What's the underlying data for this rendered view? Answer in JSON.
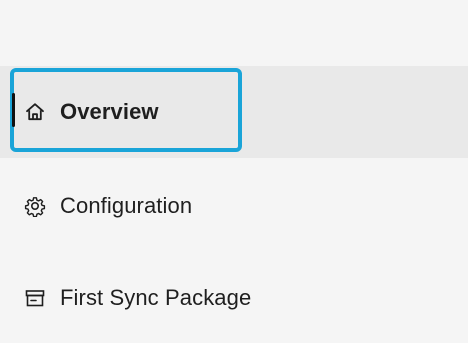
{
  "navigation": {
    "items": [
      {
        "label": "Overview",
        "icon": "home-icon",
        "selected": true
      },
      {
        "label": "Configuration",
        "icon": "gear-icon",
        "selected": false
      },
      {
        "label": "First Sync Package",
        "icon": "package-icon",
        "selected": false
      }
    ]
  },
  "colors": {
    "focus": "#1aa4d8",
    "selected_background": "#e9e9e9",
    "background": "#f5f5f5",
    "text": "#1f1f1f"
  }
}
